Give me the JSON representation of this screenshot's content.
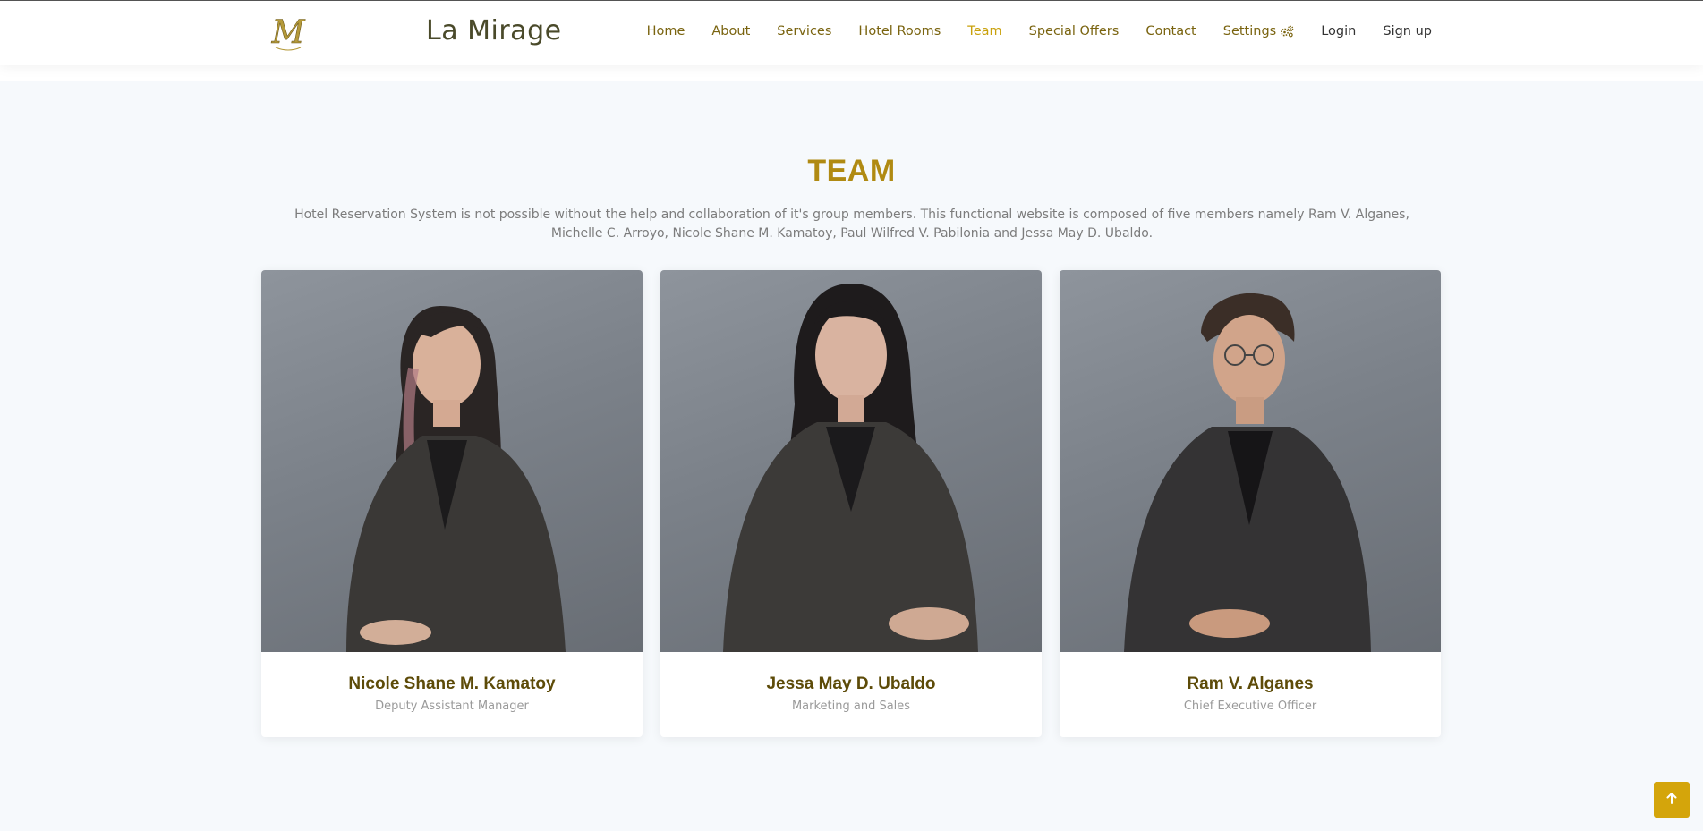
{
  "brand": {
    "name": "La Mirage",
    "logo_letter": "M"
  },
  "nav": {
    "items": [
      {
        "label": "Home",
        "state": "default"
      },
      {
        "label": "About",
        "state": "default"
      },
      {
        "label": "Services",
        "state": "default"
      },
      {
        "label": "Hotel Rooms",
        "state": "default"
      },
      {
        "label": "Team",
        "state": "active"
      },
      {
        "label": "Special Offers",
        "state": "default"
      },
      {
        "label": "Contact",
        "state": "default"
      },
      {
        "label": "Settings",
        "state": "default",
        "icon": "gears-icon"
      },
      {
        "label": "Login",
        "state": "plain"
      },
      {
        "label": "Sign up",
        "state": "plain"
      }
    ]
  },
  "team": {
    "title": "TEAM",
    "description": "Hotel Reservation System is not possible without the help and collaboration of it's group members. This functional website is composed of five members namely Ram V. Alganes, Michelle C. Arroyo, Nicole Shane M. Kamatoy, Paul Wilfred V. Pabilonia and Jessa May D. Ubaldo.",
    "members": [
      {
        "name": "Nicole Shane M. Kamatoy",
        "role": "Deputy Assistant Manager",
        "photo": "photo of team member"
      },
      {
        "name": "Jessa May D. Ubaldo",
        "role": "Marketing and Sales",
        "photo": "photo of team member"
      },
      {
        "name": "Ram V. Alganes",
        "role": "Chief Executive Officer",
        "photo": "photo of team member"
      }
    ]
  },
  "colors": {
    "accent": "#c9a10c",
    "nav_text": "#7a6410",
    "title": "#b08a12",
    "name": "#5d4b08",
    "section_bg": "#f6f9fc",
    "back_to_top": "#d4a50b"
  },
  "back_to_top": {
    "icon": "arrow-up-icon"
  }
}
